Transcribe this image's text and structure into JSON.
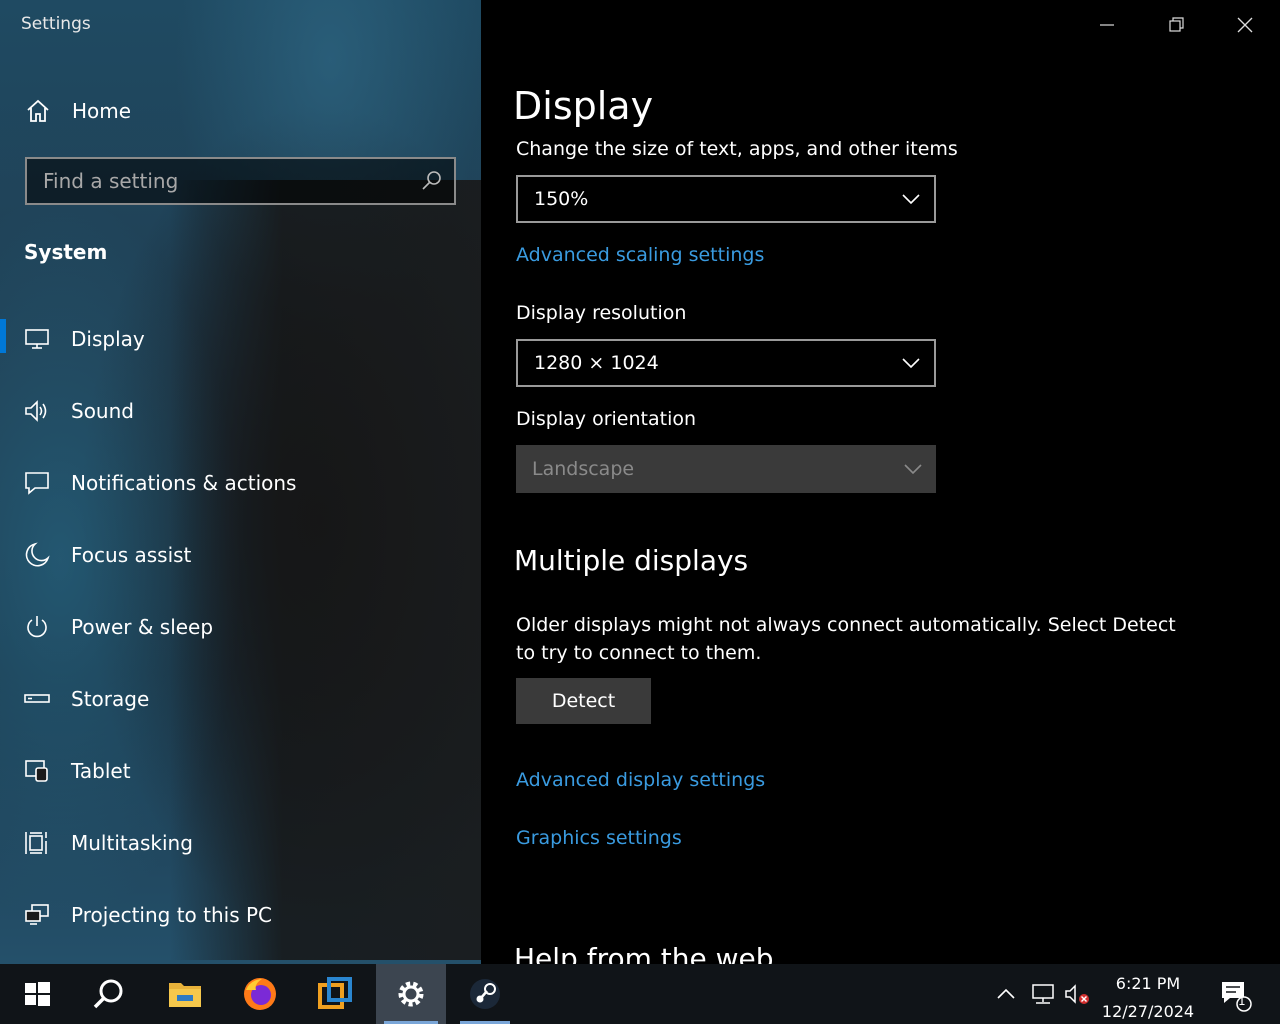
{
  "window": {
    "title": "Settings",
    "controls": {
      "minimize": "minimize",
      "restore": "restore",
      "close": "close"
    }
  },
  "sidebar": {
    "home_label": "Home",
    "search": {
      "placeholder": "Find a setting",
      "value": ""
    },
    "section": "System",
    "items": [
      {
        "label": "Display",
        "icon": "monitor-icon",
        "active": true
      },
      {
        "label": "Sound",
        "icon": "speaker-icon"
      },
      {
        "label": "Notifications & actions",
        "icon": "notification-icon"
      },
      {
        "label": "Focus assist",
        "icon": "moon-icon"
      },
      {
        "label": "Power & sleep",
        "icon": "power-icon"
      },
      {
        "label": "Storage",
        "icon": "storage-icon"
      },
      {
        "label": "Tablet",
        "icon": "tablet-icon"
      },
      {
        "label": "Multitasking",
        "icon": "multitasking-icon"
      },
      {
        "label": "Projecting to this PC",
        "icon": "projecting-icon"
      }
    ]
  },
  "main": {
    "title": "Display",
    "scale": {
      "label": "Change the size of text, apps, and other items",
      "value": "150%"
    },
    "advanced_scaling_link": "Advanced scaling settings",
    "resolution": {
      "label": "Display resolution",
      "value": "1280 × 1024"
    },
    "orientation": {
      "label": "Display orientation",
      "value": "Landscape"
    },
    "multiple_displays": {
      "heading": "Multiple displays",
      "description": "Older displays might not always connect automatically. Select Detect to try to connect to them.",
      "detect_label": "Detect"
    },
    "advanced_display_link": "Advanced display settings",
    "graphics_link": "Graphics settings",
    "help_heading": "Help from the web"
  },
  "taskbar": {
    "apps": [
      "start-icon",
      "search-icon",
      "file-explorer-icon",
      "firefox-icon",
      "virtualbox-icon",
      "settings-icon",
      "steam-icon"
    ],
    "clock": {
      "time": "6:21 PM",
      "date": "12/27/2024"
    },
    "notification_count": "1"
  },
  "colors": {
    "accent": "#0078d7",
    "link": "#3a9be0"
  }
}
